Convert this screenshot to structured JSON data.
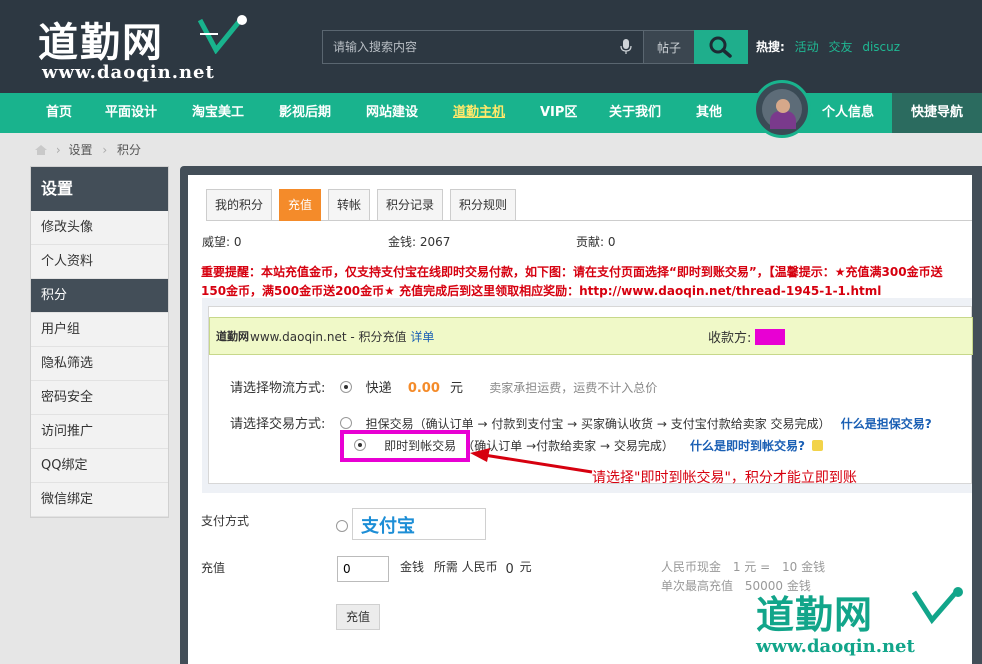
{
  "header": {
    "logo_cn": "道勤网",
    "logo_url": "www.daoqin.net",
    "search_placeholder": "请输入搜索内容",
    "search_scope": "帖子",
    "hot_label": "热搜:",
    "hot_links": [
      "活动",
      "交友",
      "discuz"
    ]
  },
  "nav": {
    "items": [
      "首页",
      "平面设计",
      "淘宝美工",
      "影视后期",
      "网站建设",
      "道勤主机",
      "VIP区",
      "关于我们",
      "其他"
    ],
    "active_index": 5,
    "user_info": "个人信息",
    "quick_nav": "快捷导航"
  },
  "breadcrumb": [
    "设置",
    "积分"
  ],
  "sidebar": {
    "title": "设置",
    "items": [
      "修改头像",
      "个人资料",
      "积分",
      "用户组",
      "隐私筛选",
      "密码安全",
      "访问推广",
      "QQ绑定",
      "微信绑定"
    ],
    "active_index": 2
  },
  "tabs": {
    "items": [
      "我的积分",
      "充值",
      "转帐",
      "积分记录",
      "积分规则"
    ],
    "active_index": 1
  },
  "stats": {
    "prestige": "威望: 0",
    "money": "金钱: 2067",
    "contribution": "贡献: 0"
  },
  "notice": "重要提醒：本站充值金币，仅支持支付宝在线即时交易付款，如下图：请在支付页面选择“即时到账交易”，【温馨提示：★充值满300金币送150金币，满500金币送200金币★ 充值完成后到这里领取相应奖励：http://www.daoqin.net/thread-1945-1-1.html",
  "pay": {
    "head_logo": "道勤网",
    "head_site": "www.daoqin.net - 积分充值",
    "head_detail": "详单",
    "receiver": "收款方:",
    "logistics_label": "请选择物流方式:",
    "logistics_option": "快递",
    "logistics_amount": "0.00",
    "logistics_unit": "元",
    "logistics_note": "卖家承担运费，运费不计入总价",
    "trade_label": "请选择交易方式:",
    "trade_escrow": "担保交易（确认订单 → 付款到支付宝 → 买家确认收货 → 支付宝付款给卖家 交易完成）",
    "trade_escrow_link": "什么是担保交易?",
    "trade_instant": "即时到帐交易",
    "trade_instant_flow": "（确认订单 →付款给卖家 → 交易完成）",
    "trade_instant_link": "什么是即时到帐交易?"
  },
  "annotation": "请选择\"即时到帐交易\"，积分才能立即到账",
  "form": {
    "pay_method_label": "支付方式",
    "alipay_text": "支付宝",
    "charge_label": "充值",
    "charge_value": "0",
    "charge_unit": "金钱",
    "need_rmb": "所需 人民币",
    "need_rmb_value": "0",
    "need_rmb_unit": "元",
    "rate_text": "人民币现金",
    "rate_value": "1 元 =",
    "rate_money": "10 金钱",
    "max_text": "单次最高充值",
    "max_value": "50000 金钱",
    "submit": "充值"
  },
  "watermark": {
    "cn": "道勤网",
    "url": "www.daoqin.net"
  },
  "colors": {
    "header_bg": "#2d3842",
    "nav_bg": "#19b38d",
    "accent_orange": "#f48b2a",
    "notice_red": "#d6000f",
    "highlight_magenta": "#e800d3"
  }
}
